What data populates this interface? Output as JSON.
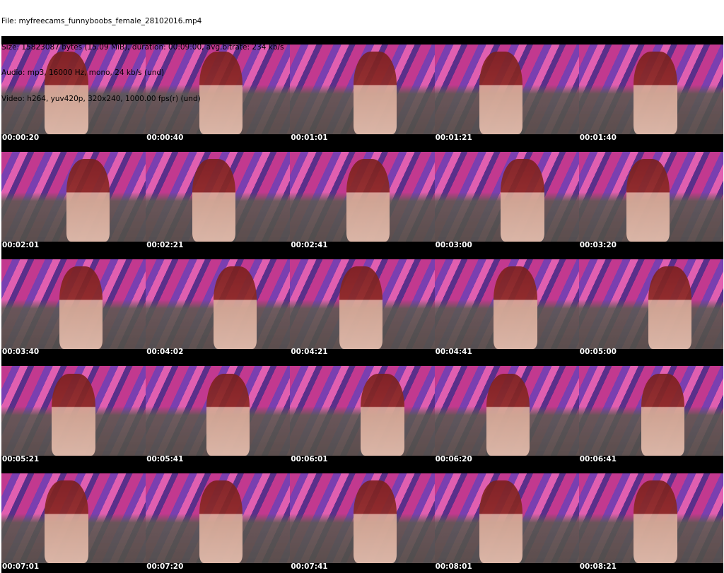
{
  "header": {
    "file": "File: myfreecams_funnyboobs_female_28102016.mp4",
    "size": "Size: 15823087 bytes (15.09 MiB), duration: 00:09:00, avg.bitrate: 234 kb/s",
    "audio": "Audio: mp3, 16000 Hz, mono, 24 kb/s (und)",
    "video": "Video: h264, yuv420p, 320x240, 1000.00 fps(r) (und)"
  },
  "timestamps": [
    "00:00:20",
    "00:00:40",
    "00:01:01",
    "00:01:21",
    "00:01:40",
    "00:02:01",
    "00:02:21",
    "00:02:41",
    "00:03:00",
    "00:03:20",
    "00:03:40",
    "00:04:02",
    "00:04:21",
    "00:04:41",
    "00:05:00",
    "00:05:21",
    "00:05:41",
    "00:06:01",
    "00:06:20",
    "00:06:41",
    "00:07:01",
    "00:07:20",
    "00:07:41",
    "00:08:01",
    "00:08:21"
  ]
}
